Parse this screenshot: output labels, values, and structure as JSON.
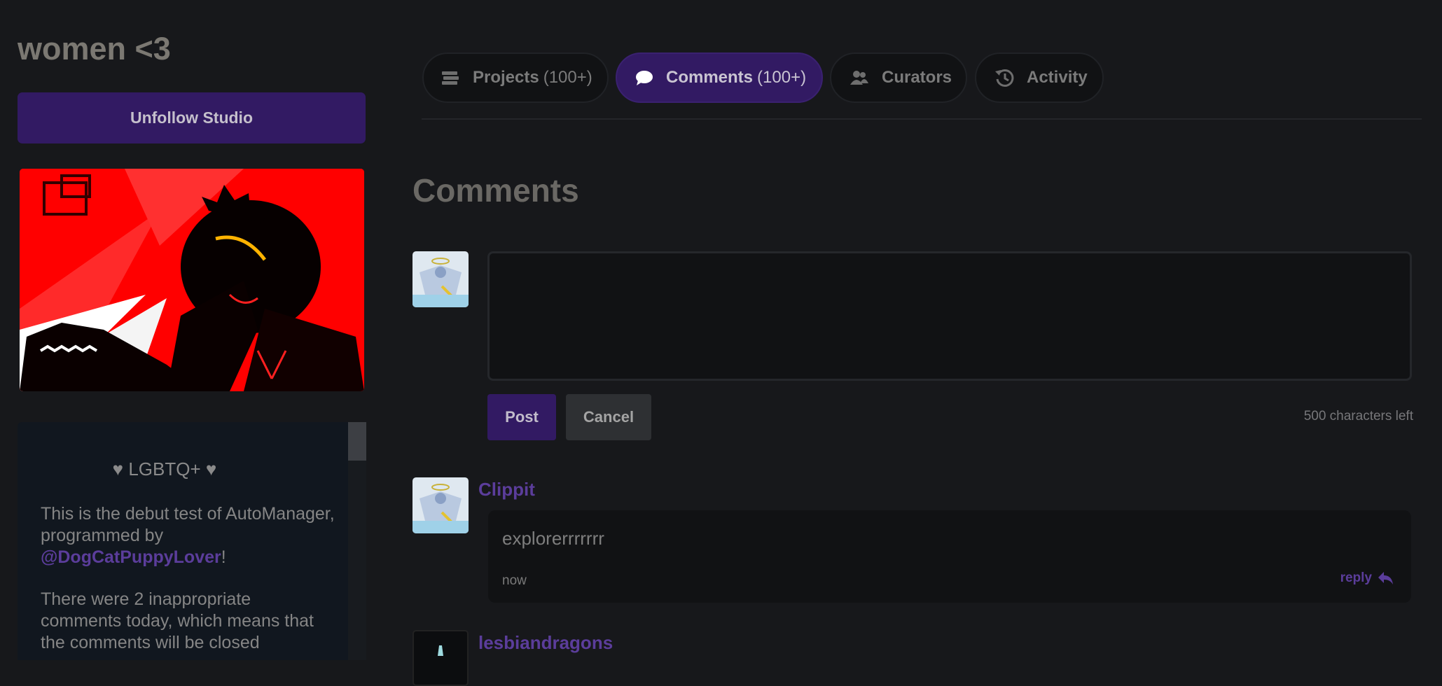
{
  "studio": {
    "title": "women <3",
    "follow_button": "Unfollow Studio"
  },
  "description": {
    "heading": "♥ LGBTQ+ ♥",
    "para1_prefix": "This is the debut test of AutoManager, programmed by ",
    "para1_mention": "@DogCatPuppyLover",
    "para1_suffix": "!",
    "para2": "There were 2 inappropriate comments today, which means that the comments will be closed"
  },
  "tabs": [
    {
      "label": "Projects",
      "count": "(100+)",
      "icon": "projects-icon"
    },
    {
      "label": "Comments",
      "count": "(100+)",
      "icon": "comment-bubble-icon",
      "active": true
    },
    {
      "label": "Curators",
      "count": "",
      "icon": "curators-icon"
    },
    {
      "label": "Activity",
      "count": "",
      "icon": "history-icon"
    }
  ],
  "comments_section": {
    "heading": "Comments",
    "post_label": "Post",
    "cancel_label": "Cancel",
    "chars_left": "500 characters left"
  },
  "comments": [
    {
      "user": "Clippit",
      "text": "explorerrrrrrr",
      "time": "now",
      "reply_label": "reply"
    },
    {
      "user": "lesbiandragons"
    }
  ],
  "colors": {
    "accent": "#321a63",
    "link": "#5b3d9b",
    "background": "#17181b"
  }
}
